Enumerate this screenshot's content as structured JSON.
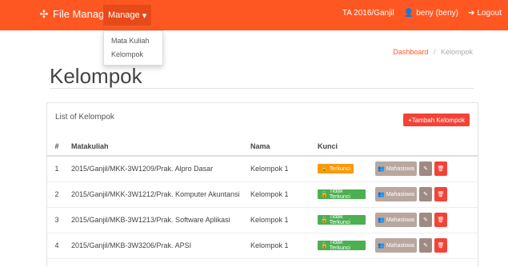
{
  "navbar": {
    "brand": "File Manager",
    "manage_label": "Manage",
    "period": "TA 2016/Ganjil",
    "user": "beny (beny)",
    "logout": "Logout"
  },
  "dropdown": {
    "items": [
      "Mata Kuliah",
      "Kelompok"
    ]
  },
  "breadcrumb": {
    "dashboard": "Dashboard",
    "separator": "/",
    "current": "Kelompok"
  },
  "page": {
    "title": "Kelompok"
  },
  "panel": {
    "title": "List of Kelompok",
    "add_button": "Tambah Kelompok"
  },
  "table": {
    "headers": {
      "no": "#",
      "matakuliah": "Matakuliah",
      "nama": "Nama",
      "kunci": "Kunci"
    },
    "rows": [
      {
        "no": "1",
        "matakuliah": "2015/Ganjil/MKK-3W1209/Prak. Alpro Dasar",
        "nama": "Kelompok 1",
        "kunci": "Terkunci",
        "status": "locked"
      },
      {
        "no": "2",
        "matakuliah": "2015/Ganjil/MKK-3W1212/Prak. Komputer Akuntansi",
        "nama": "Kelompok 1",
        "kunci": "Tidak Terkunci",
        "status": "unlocked"
      },
      {
        "no": "3",
        "matakuliah": "2015/Ganjil/MKB-3W1213/Prak. Software Aplikasi",
        "nama": "Kelompok 1",
        "kunci": "Tidak Terkunci",
        "status": "unlocked"
      },
      {
        "no": "4",
        "matakuliah": "2015/Ganjil/MKB-3W3206/Prak. APSI",
        "nama": "Kelompok 1",
        "kunci": "Tidak Terkunci",
        "status": "unlocked"
      }
    ],
    "mahasiswa_label": "Mahasiswa"
  },
  "colors": {
    "primary": "#ff5722",
    "danger": "#f44336",
    "warning": "#ff9800",
    "success": "#4caf50"
  }
}
